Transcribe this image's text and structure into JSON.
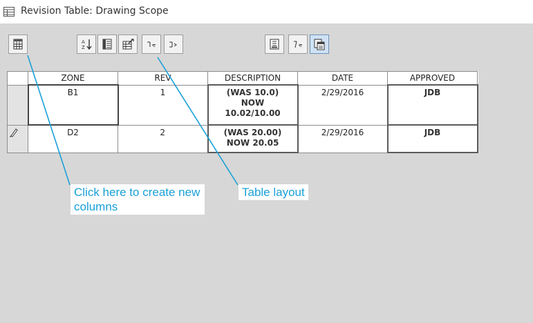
{
  "window": {
    "title": "Revision Table: Drawing Scope",
    "title_icon": "table-icon"
  },
  "toolbar": {
    "buttons": [
      {
        "name": "add-column-button",
        "icon": "column-chooser-icon"
      },
      {
        "name": "sort-button",
        "icon": "sort-az-icon"
      },
      {
        "name": "export-button",
        "icon": "export-icon"
      },
      {
        "name": "table-layout-button",
        "icon": "table-layout-icon"
      },
      {
        "name": "insert-row-above-button",
        "icon": "insert-row-above-icon"
      },
      {
        "name": "insert-row-below-button",
        "icon": "insert-row-below-icon"
      },
      {
        "name": "text-style-button",
        "icon": "text-style-icon"
      },
      {
        "name": "merge-button",
        "icon": "merge-icon"
      },
      {
        "name": "copy-button",
        "icon": "copy-icon"
      }
    ]
  },
  "table": {
    "headers": [
      "ZONE",
      "REV",
      "DESCRIPTION",
      "DATE",
      "APPROVED"
    ],
    "rows": [
      {
        "zone": "B1",
        "rev": "1",
        "description": [
          "(WAS 10.0)",
          "NOW",
          "10.02/10.00"
        ],
        "date": "2/29/2016",
        "approved": "JDB"
      },
      {
        "zone": "D2",
        "rev": "2",
        "description": [
          "(WAS 20.00)",
          "NOW 20.05"
        ],
        "date": "2/29/2016",
        "approved": "JDB",
        "row_icon": "pencil-icon"
      }
    ]
  },
  "callouts": {
    "columns": "Click here to create new columns",
    "layout": "Table layout"
  },
  "colors": {
    "callout_text": "#1aa0d8",
    "leader_line": "#1aa0d8",
    "panel_bg": "#d7d7d7"
  }
}
